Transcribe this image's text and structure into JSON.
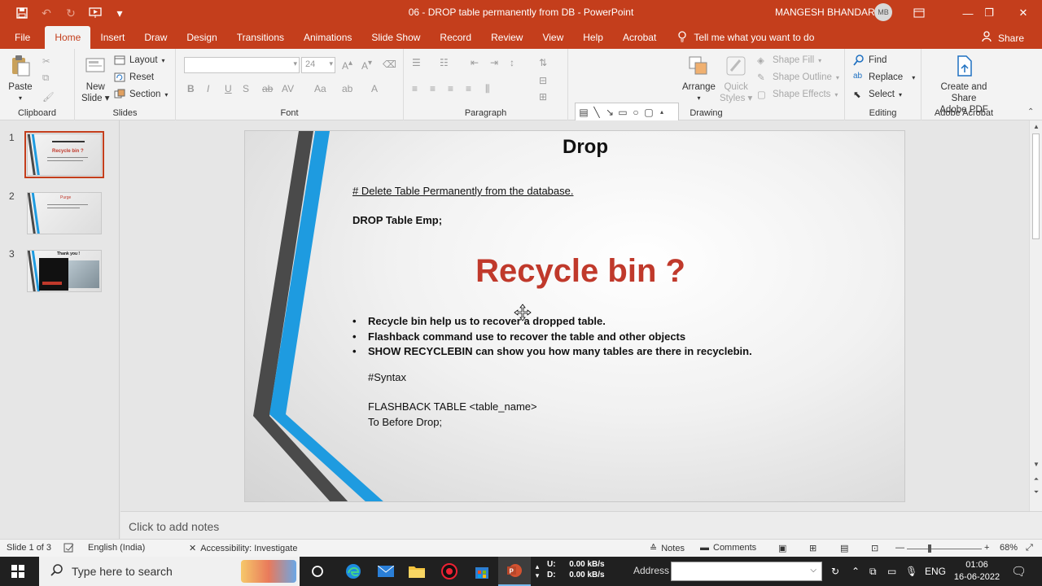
{
  "window": {
    "title": "06 - DROP table permanently from DB  -  PowerPoint",
    "user_name": "MANGESH BHANDARI",
    "user_initials": "MB"
  },
  "tabs": [
    "File",
    "Home",
    "Insert",
    "Draw",
    "Design",
    "Transitions",
    "Animations",
    "Slide Show",
    "Record",
    "Review",
    "View",
    "Help",
    "Acrobat"
  ],
  "active_tab": "Home",
  "tell_me": "Tell me what you want to do",
  "share_label": "Share",
  "ribbon": {
    "clipboard": {
      "label": "Clipboard",
      "paste": "Paste"
    },
    "slides": {
      "label": "Slides",
      "new_slide_1": "New",
      "new_slide_2": "Slide",
      "layout": "Layout",
      "reset": "Reset",
      "section": "Section"
    },
    "font": {
      "label": "Font",
      "size": "24"
    },
    "paragraph": {
      "label": "Paragraph"
    },
    "drawing": {
      "label": "Drawing",
      "arrange": "Arrange",
      "quick_styles_1": "Quick",
      "quick_styles_2": "Styles",
      "shape_fill": "Shape Fill",
      "shape_outline": "Shape Outline",
      "shape_effects": "Shape Effects"
    },
    "editing": {
      "label": "Editing",
      "find": "Find",
      "replace": "Replace",
      "select": "Select"
    },
    "acrobat": {
      "label": "Adobe Acrobat",
      "create_1": "Create and Share",
      "create_2": "Adobe PDF"
    }
  },
  "thumbnails": [
    {
      "num": "1",
      "title": "Recycle bin ?"
    },
    {
      "num": "2",
      "title": "Purge"
    },
    {
      "num": "3",
      "title": "Thank you !"
    }
  ],
  "slide": {
    "title": "Drop",
    "subtitle": "# Delete  Table Permanently from the database.",
    "command": "DROP  Table  Emp;",
    "heading": "Recycle bin ?",
    "bullets": [
      "Recycle  bin  help  us to recover  a  dropped table.",
      "Flashback  command use to recover the  table and other objects",
      "SHOW RECYCLEBIN     can show you how many tables are there in recyclebin."
    ],
    "syntax_label": "#Syntax",
    "syntax_line1": "FLASHBACK  TABLE  <table_name>",
    "syntax_line2": "To Before Drop;"
  },
  "notes_placeholder": "Click to add notes",
  "status": {
    "slide_count": "Slide 1 of 3",
    "language": "English (India)",
    "accessibility": "Accessibility: Investigate",
    "notes": "Notes",
    "comments": "Comments",
    "zoom": "68%"
  },
  "taskbar": {
    "search_placeholder": "Type here to search",
    "net_up_label": "U:",
    "net_up": "0.00 kB/s",
    "net_down_label": "D:",
    "net_down": "0.00 kB/s",
    "address_label": "Address",
    "language": "ENG",
    "time": "01:06",
    "date": "16-06-2022"
  },
  "colors": {
    "brand": "#c43e1c",
    "heading_red": "#c0392b",
    "stripe_blue": "#1e9be0",
    "stripe_dark": "#4a4a4a"
  }
}
